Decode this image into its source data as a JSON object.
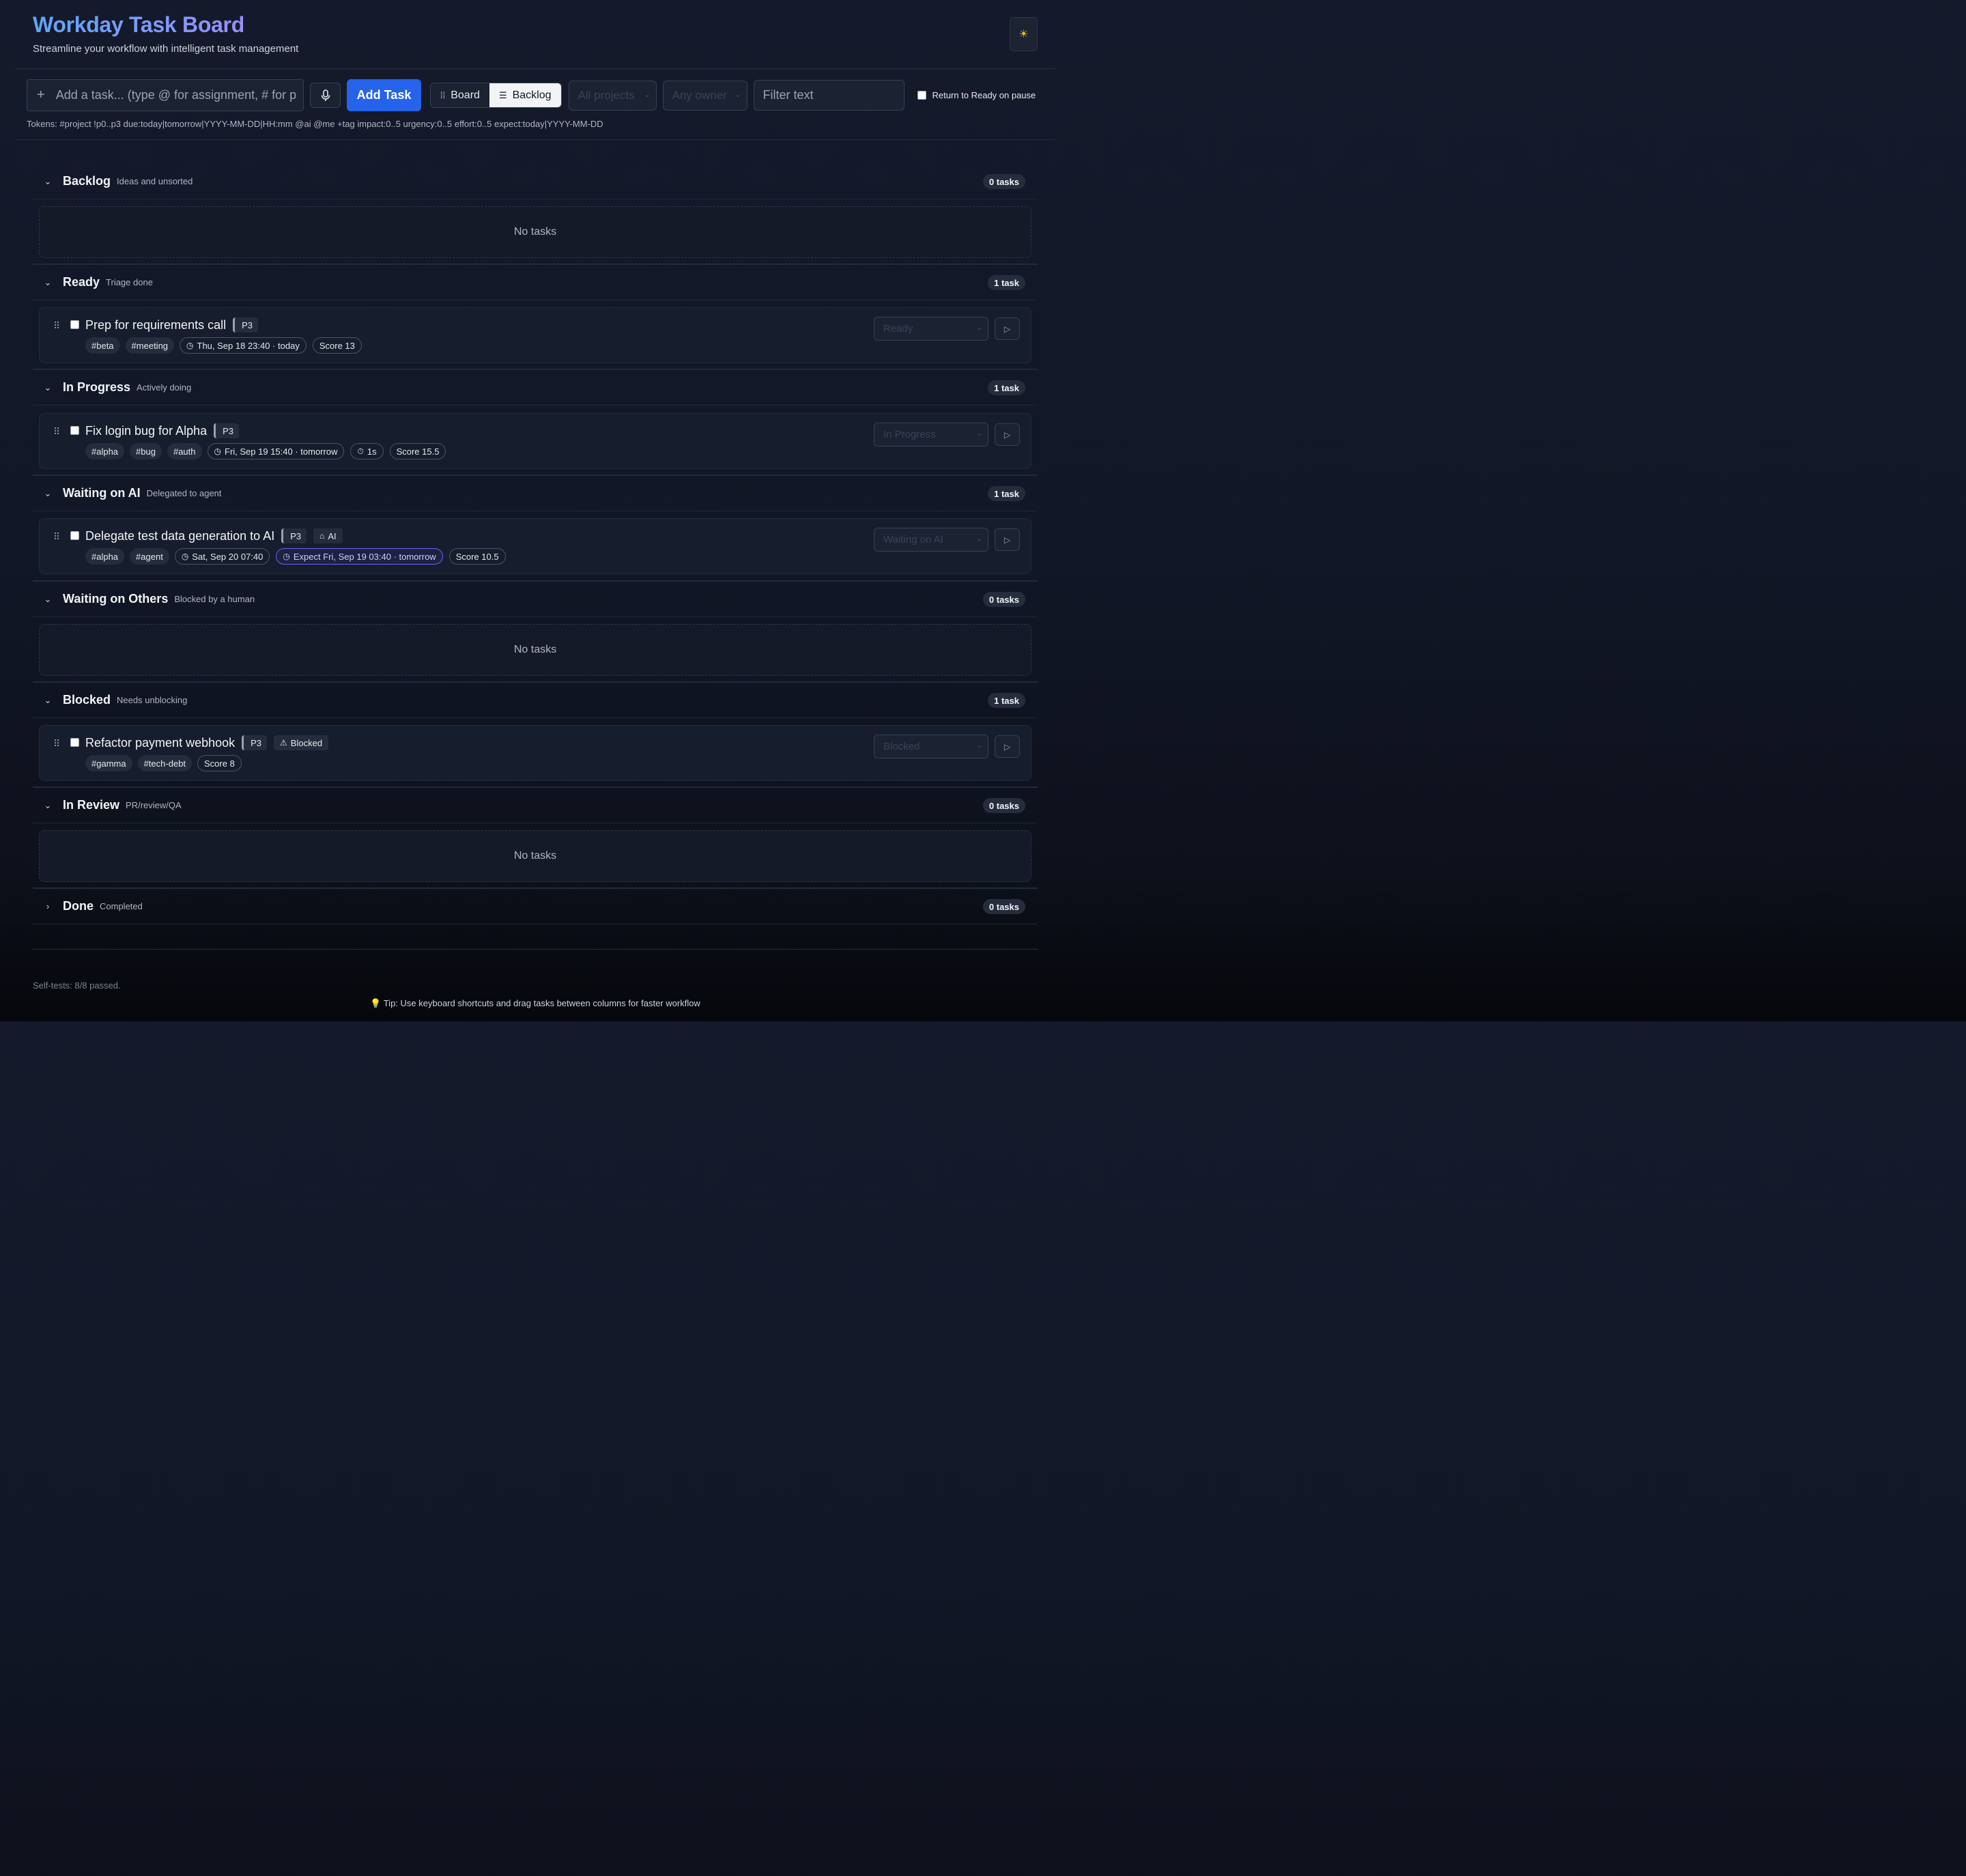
{
  "app": {
    "title": "Workday Task Board",
    "subtitle": "Streamline your workflow with intelligent task management",
    "theme_icon": "sun-icon"
  },
  "toolbar": {
    "add_placeholder": "Add a task... (type @ for assignment, # for p",
    "add_button": "Add Task",
    "view_board": "Board",
    "view_backlog": "Backlog",
    "active_view": "Backlog",
    "project_filter": "All projects",
    "owner_filter": "Any owner",
    "filter_placeholder": "Filter text",
    "return_to_ready": "Return to Ready on pause",
    "return_to_ready_checked": false
  },
  "tokens_hint": "Tokens: #project !p0..p3 due:today|tomorrow|YYYY-MM-DD|HH:mm @ai @me +tag impact:0..5 urgency:0..5 effort:0..5 expect:today|YYYY-MM-DD",
  "sections": [
    {
      "name": "Backlog",
      "desc": "Ideas and unsorted",
      "count": "0 tasks",
      "expanded": true,
      "empty": "No tasks"
    },
    {
      "name": "Ready",
      "desc": "Triage done",
      "count": "1 task",
      "expanded": true,
      "task": {
        "title": "Prep for requirements call",
        "priority": "P3",
        "tags": [
          "#beta",
          "#meeting"
        ],
        "due": "Thu, Sep 18 23:40 · today",
        "score": "Score 13",
        "status": "Ready"
      }
    },
    {
      "name": "In Progress",
      "desc": "Actively doing",
      "count": "1 task",
      "expanded": true,
      "task": {
        "title": "Fix login bug for Alpha",
        "priority": "P3",
        "tags": [
          "#alpha",
          "#bug",
          "#auth"
        ],
        "due": "Fri, Sep 19 15:40 · tomorrow",
        "timer": "1s",
        "score": "Score 15.5",
        "status": "In Progress"
      }
    },
    {
      "name": "Waiting on AI",
      "desc": "Delegated to agent",
      "count": "1 task",
      "expanded": true,
      "task": {
        "title": "Delegate test data generation to AI",
        "priority": "P3",
        "badge": "AI",
        "tags": [
          "#alpha",
          "#agent"
        ],
        "due": "Sat, Sep 20 07:40",
        "expect": "Expect Fri, Sep 19 03:40 · tomorrow",
        "score": "Score 10.5",
        "status": "Waiting on AI"
      }
    },
    {
      "name": "Waiting on Others",
      "desc": "Blocked by a human",
      "count": "0 tasks",
      "expanded": true,
      "empty": "No tasks"
    },
    {
      "name": "Blocked",
      "desc": "Needs unblocking",
      "count": "1 task",
      "expanded": true,
      "task": {
        "title": "Refactor payment webhook",
        "priority": "P3",
        "badge": "Blocked",
        "tags": [
          "#gamma",
          "#tech-debt"
        ],
        "score": "Score 8",
        "status": "Blocked"
      }
    },
    {
      "name": "In Review",
      "desc": "PR/review/QA",
      "count": "0 tasks",
      "expanded": true,
      "empty": "No tasks"
    },
    {
      "name": "Done",
      "desc": "Completed",
      "count": "0 tasks",
      "expanded": false
    }
  ],
  "footer": {
    "self_tests": "Self-tests: 8/8 passed.",
    "tip": "💡 Tip: Use keyboard shortcuts and drag tasks between columns for faster workflow"
  },
  "colors": {
    "accent": "#2563eb",
    "title_gradient_start": "#60a5fa",
    "title_gradient_end": "#a78bfa",
    "expect_border": "#6366f1"
  }
}
